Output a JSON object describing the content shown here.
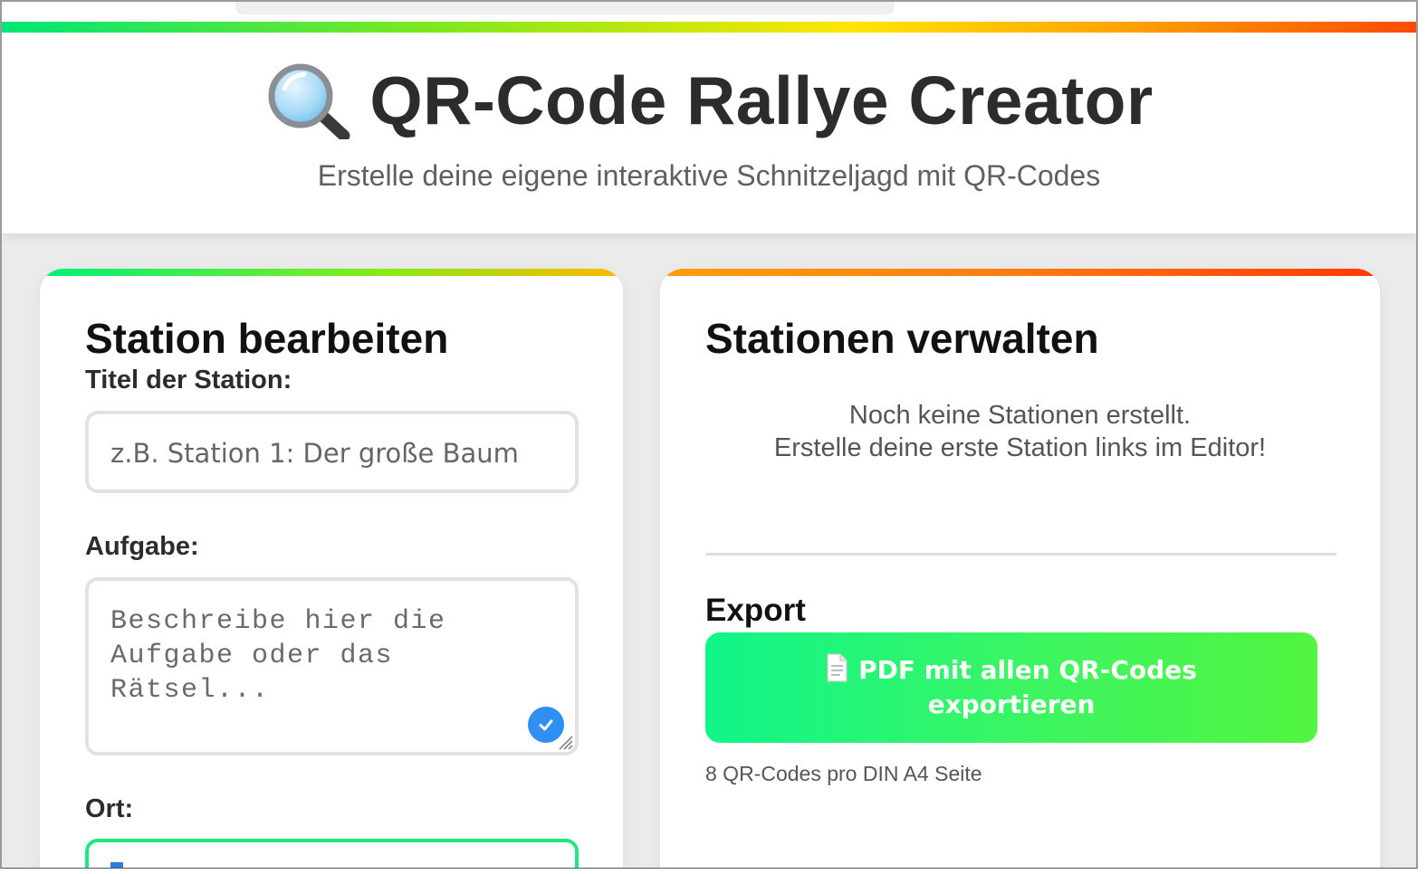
{
  "header": {
    "title": "QR-Code Rallye Creator",
    "subtitle": "Erstelle deine eigene interaktive Schnitzeljagd mit QR-Codes",
    "icon": "magnifier-icon"
  },
  "editor": {
    "heading": "Station bearbeiten",
    "title_label": "Titel der Station:",
    "title_placeholder": "z.B. Station 1: Der große Baum",
    "task_label": "Aufgabe:",
    "task_placeholder": "Beschreibe hier die Aufgabe oder das Rätsel...",
    "location_label": "Ort:"
  },
  "manager": {
    "heading": "Stationen verwalten",
    "empty_line1": "Noch keine Stationen erstellt.",
    "empty_line2": "Erstelle deine erste Station links im Editor!",
    "export_heading": "Export",
    "export_button_line1": "PDF mit allen QR-Codes",
    "export_button_line2": "exportieren",
    "export_hint": "8 QR-Codes pro DIN A4 Seite"
  },
  "colors": {
    "accent_green": "#10f58a",
    "accent_orange": "#ff7a10",
    "focus_border": "#1de97f",
    "check_blue": "#2f8ff2"
  }
}
